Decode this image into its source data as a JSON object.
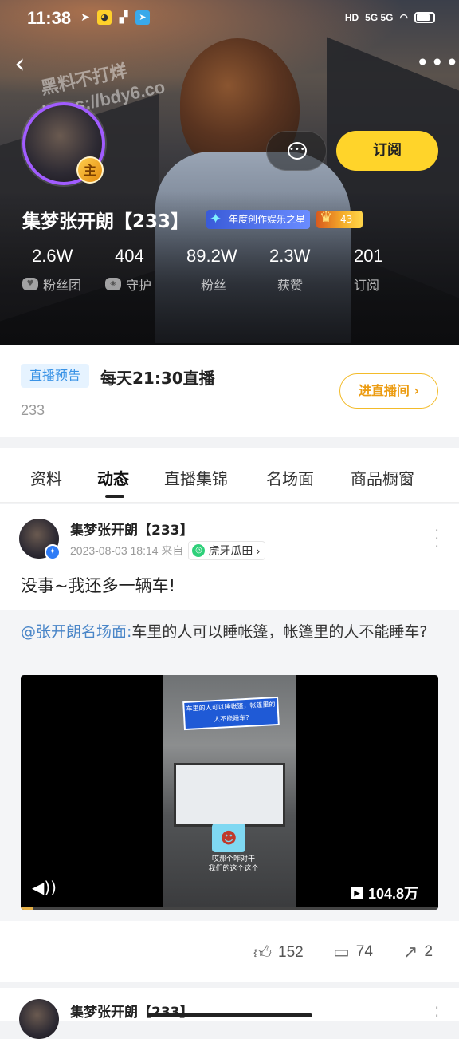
{
  "status_bar": {
    "time": "11:38",
    "network": "5G 5G",
    "hd": "HD"
  },
  "watermark": {
    "line1": "黑料不打烊",
    "line2": "https://bdy6.co"
  },
  "profile": {
    "name": "集梦张开朗【233】",
    "level_badge": "主",
    "honor": "年度创作娱乐之星",
    "fan_level": "43",
    "subscribe_label": "订阅",
    "stats": [
      {
        "value": "2.6W",
        "label": "粉丝团"
      },
      {
        "value": "404",
        "label": "守护"
      },
      {
        "value": "89.2W",
        "label": "粉丝"
      },
      {
        "value": "2.3W",
        "label": "获赞"
      },
      {
        "value": "201",
        "label": "订阅"
      }
    ]
  },
  "live_notice": {
    "tag": "直播预告",
    "title": "每天21:30直播",
    "count": "233",
    "enter_label": "进直播间 ›"
  },
  "tabs": [
    "资料",
    "动态",
    "直播集锦",
    "名场面",
    "商品橱窗"
  ],
  "active_tab": "动态",
  "post": {
    "author": "集梦张开朗【233】",
    "date": "2023-08-03 18:14 来自",
    "source": "虎牙瓜田",
    "text": "没事~我还多一辆车!",
    "quote_mention": "@张开朗名场面:",
    "quote_text": "车里的人可以睡帐篷，帐篷里的人不能睡车?",
    "video": {
      "caption_top": "车里的人可以睡帐篷，帐篷里的人不能睡车?",
      "caption_bottom_1": "哎那个咋对干",
      "caption_bottom_2": "我们的这个这个",
      "views": "104.8万",
      "progress": 0.03
    },
    "likes": "152",
    "comments": "74",
    "shares": "2"
  },
  "next_post": {
    "author": "集梦张开朗【233】"
  }
}
